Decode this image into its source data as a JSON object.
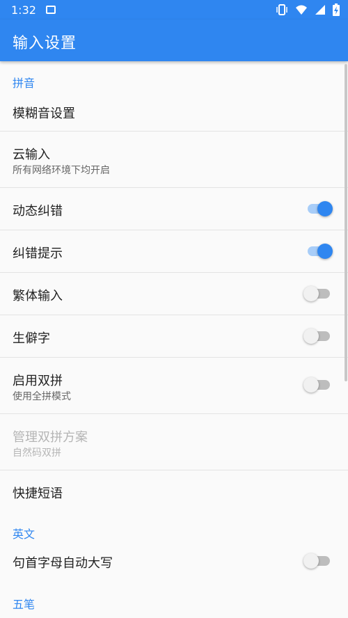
{
  "status_bar": {
    "time": "1:32",
    "icons": [
      "image-icon",
      "vibrate-icon",
      "wifi-icon",
      "signal-icon",
      "battery-charging-icon"
    ]
  },
  "app_bar": {
    "title": "输入设置"
  },
  "sections": {
    "pinyin": "拼音",
    "english": "英文",
    "wubi": "五笔"
  },
  "items": {
    "fuzzy": {
      "title": "模糊音设置"
    },
    "cloud": {
      "title": "云输入",
      "subtitle": "所有网络环境下均开启"
    },
    "dynamic_correction": {
      "title": "动态纠错",
      "enabled": true
    },
    "correction_hint": {
      "title": "纠错提示",
      "enabled": true
    },
    "traditional": {
      "title": "繁体输入",
      "enabled": false
    },
    "rare_chars": {
      "title": "生僻字",
      "enabled": false
    },
    "double_pinyin": {
      "title": "启用双拼",
      "subtitle": "使用全拼模式",
      "enabled": false
    },
    "double_scheme": {
      "title": "管理双拼方案",
      "subtitle": "自然码双拼",
      "disabled": true
    },
    "quick_phrases": {
      "title": "快捷短语"
    },
    "auto_capitalize": {
      "title": "句首字母自动大写",
      "enabled": false
    }
  },
  "colors": {
    "accent": "#2f86f0",
    "text": "#222222",
    "secondary": "#666666",
    "disabled": "#b5b5b5"
  }
}
